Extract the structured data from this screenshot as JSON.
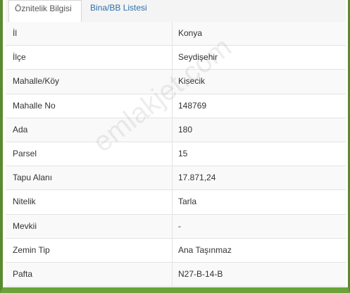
{
  "tabs": [
    {
      "label": "Öznitelik Bilgisi",
      "active": true
    },
    {
      "label": "Bina/BB Listesi",
      "active": false
    }
  ],
  "rows": [
    {
      "label": "İl",
      "value": "Konya"
    },
    {
      "label": "İlçe",
      "value": "Seydişehir"
    },
    {
      "label": "Mahalle/Köy",
      "value": "Kisecik"
    },
    {
      "label": "Mahalle No",
      "value": "148769"
    },
    {
      "label": "Ada",
      "value": "180"
    },
    {
      "label": "Parsel",
      "value": "15"
    },
    {
      "label": "Tapu Alanı",
      "value": "17.871,24"
    },
    {
      "label": "Nitelik",
      "value": "Tarla"
    },
    {
      "label": "Mevkii",
      "value": "-"
    },
    {
      "label": "Zemin Tip",
      "value": "Ana Taşınmaz"
    },
    {
      "label": "Pafta",
      "value": "N27-B-14-B"
    }
  ],
  "watermark": "emlakjet.com",
  "colors": {
    "frame_green": "#5a8a2e",
    "tab_link": "#2f6fa8"
  }
}
